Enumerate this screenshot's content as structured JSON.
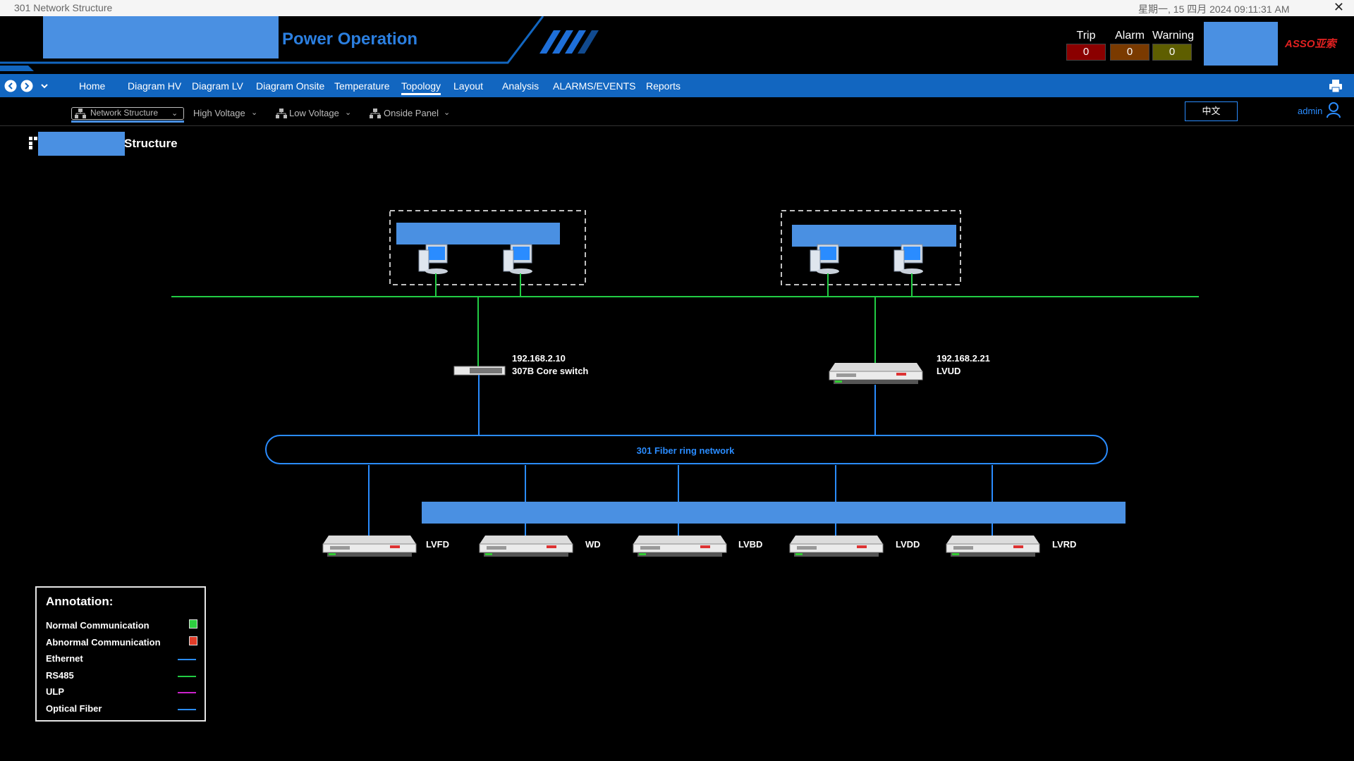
{
  "window": {
    "title": "301 Network Structure",
    "datetime": "星期一, 15 四月 2024 09:11:31 AM",
    "close_glyph": "✕"
  },
  "header": {
    "app_title": "Power Operation",
    "brand": "ASSO亚索",
    "stats": [
      {
        "label": "Trip",
        "value": "0",
        "color": "#8b0000"
      },
      {
        "label": "Alarm",
        "value": "0",
        "color": "#7a3a00"
      },
      {
        "label": "Warning",
        "value": "0",
        "color": "#5e5e00"
      }
    ]
  },
  "nav": {
    "items": [
      "Home",
      "Diagram HV",
      "Diagram LV",
      "Diagram Onsite",
      "Temperature",
      "Topology",
      "Layout",
      "Analysis",
      "ALARMS/EVENTS",
      "Reports"
    ],
    "active": "Topology"
  },
  "subnav": {
    "items": [
      "Network Structure",
      "High Voltage",
      "Low Voltage",
      "Onside Panel"
    ],
    "language_button": "中文",
    "user": "admin"
  },
  "page": {
    "title": "Structure"
  },
  "topology": {
    "core_switch": {
      "ip": "192.168.2.10",
      "name": "307B Core switch"
    },
    "lvud": {
      "ip": "192.168.2.21",
      "name": "LVUD"
    },
    "ring_label": "301 Fiber ring network",
    "devices": [
      "LVFD",
      "WD",
      "LVBD",
      "LVDD",
      "LVRD"
    ]
  },
  "legend": {
    "title": "Annotation:",
    "items": [
      {
        "label": "Normal Communication",
        "type": "box",
        "color": "#2ecc40"
      },
      {
        "label": "Abnormal Communication",
        "type": "box",
        "color": "#e03c28"
      },
      {
        "label": "Ethernet",
        "type": "line",
        "color": "#2a8cff"
      },
      {
        "label": "RS485",
        "type": "line",
        "color": "#22cc44"
      },
      {
        "label": "ULP",
        "type": "line",
        "color": "#cc22cc"
      },
      {
        "label": "Optical Fiber",
        "type": "line",
        "color": "#2a8cff"
      }
    ]
  },
  "colors": {
    "accent": "#1266c0",
    "network_green": "#22cc44",
    "network_blue": "#2a8cff"
  }
}
